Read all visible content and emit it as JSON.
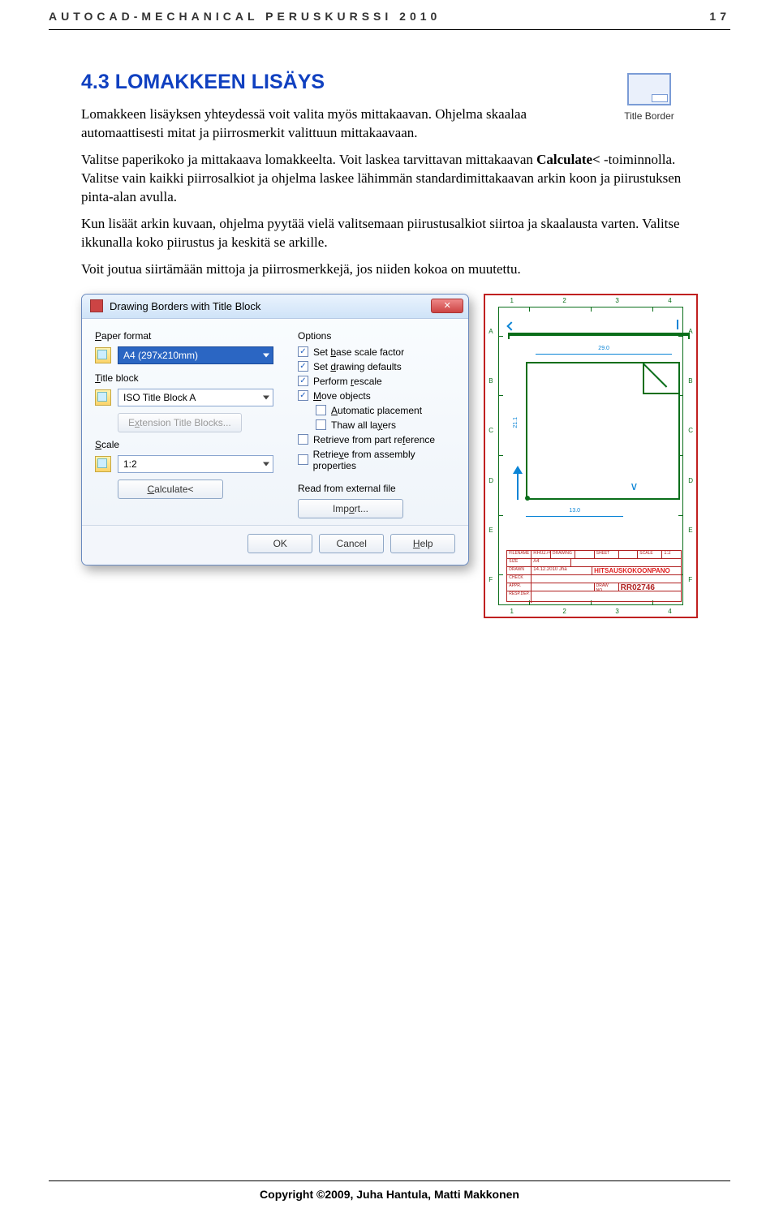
{
  "header": {
    "title": "AUTOCAD-MECHANICAL PERUSKURSSI 2010",
    "page": "17"
  },
  "title_border": {
    "label": "Title Border"
  },
  "section": {
    "heading": "4.3 LOMAKKEEN LISÄYS",
    "p1": "Lomakkeen lisäyksen yhteydessä voit valita myös mittakaavan. Ohjelma skaalaa automaattisesti mitat ja piirrosmerkit valittuun mittakaavaan.",
    "p2a": "Valitse paperikoko ja mittakaava lomakkeelta. Voit laskea tarvittavan mittakaavan ",
    "p2b": "Calculate<",
    "p2c": " -toiminnolla. Valitse vain kaikki piirrosalkiot ja ohjelma laskee lähimmän standardimittakaavan arkin koon ja piirustuksen pinta-alan avulla.",
    "p3": "Kun lisäät arkin kuvaan, ohjelma pyytää vielä valitsemaan piirustusalkiot siirtoa ja skaalausta varten. Valitse ikkunalla koko piirustus ja keskitä se arkille.",
    "p4": "Voit joutua siirtämään mittoja ja piirrosmerkkejä, jos niiden kokoa on muutettu."
  },
  "dialog": {
    "title": "Drawing Borders with Title Block",
    "close": "✕",
    "paper_format_label": "Paper format",
    "paper_format_value": "A4 (297x210mm)",
    "title_block_label": "Title block",
    "title_block_value": "ISO Title Block A",
    "ext_button": "Extension Title Blocks...",
    "scale_label": "Scale",
    "scale_value": "1:2",
    "calc_button": "Calculate<",
    "options_label": "Options",
    "opts": {
      "base_scale": "Set base scale factor",
      "drawing_defaults": "Set drawing defaults",
      "rescale": "Perform rescale",
      "move_objects": "Move objects",
      "auto_place": "Automatic placement",
      "thaw": "Thaw all layers",
      "retrieve_part": "Retrieve from part reference",
      "retrieve_asm": "Retrieve from assembly properties"
    },
    "read_ext_label": "Read from external file",
    "import_button": "Import...",
    "ok": "OK",
    "cancel": "Cancel",
    "help": "Help"
  },
  "drawing": {
    "cols": [
      "1",
      "2",
      "3",
      "4"
    ],
    "rows": [
      "A",
      "B",
      "C",
      "D",
      "E",
      "F"
    ],
    "dim_top": "29.0",
    "dim_bottom": "13.0",
    "side": "21.1",
    "tb": {
      "filename": "FILENAME",
      "filename_v": "RR02746_1",
      "drawing": "DRAWING",
      "sheet": "SHEET",
      "scale": "SCALE",
      "scale_v": "1:2",
      "size": "SIZE",
      "size_v": "A4",
      "drawn": "DRAWN",
      "drawn_v": "14.12.2010  Jha",
      "check": "CHECK",
      "appr": "APPR.",
      "resp": "RESP.DEP.",
      "title_big": "HITSAUSKOKOONPANO",
      "draw_no_lbl": "DRAW NO.",
      "draw_no": "RR02746"
    }
  },
  "footer": {
    "text": "Copyright ©2009, Juha Hantula, Matti Makkonen"
  }
}
